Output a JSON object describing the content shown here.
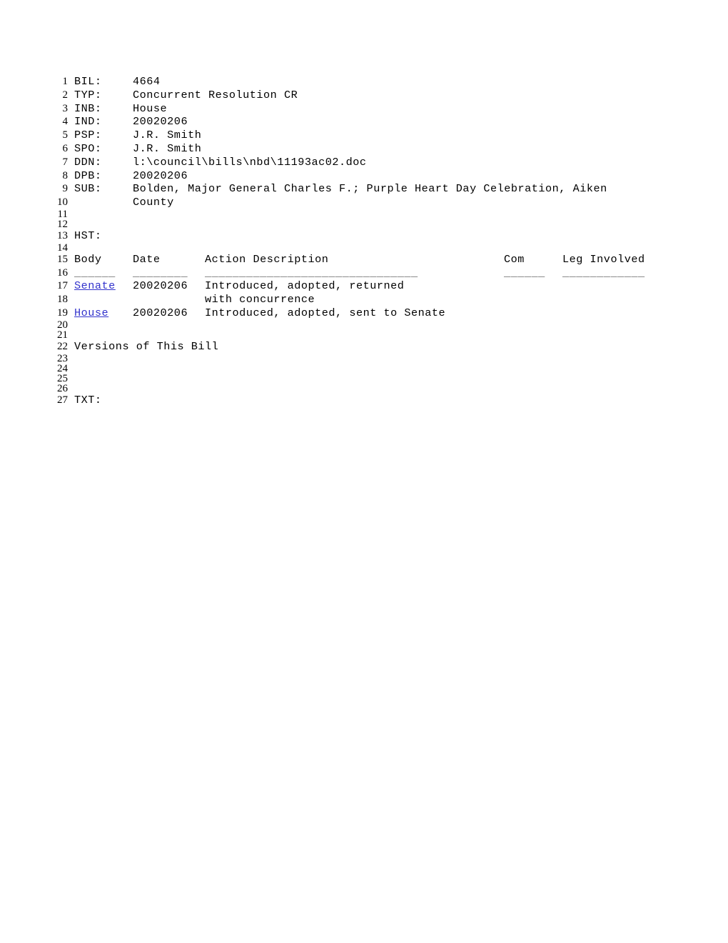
{
  "document": {
    "type": "legislative-bill-record",
    "line_count": 27
  },
  "fields": {
    "bil_label": "BIL:",
    "bil_value": "4664",
    "typ_label": "TYP:",
    "typ_value": "Concurrent Resolution CR",
    "inb_label": "INB:",
    "inb_value": "House",
    "ind_label": "IND:",
    "ind_value": "20020206",
    "psp_label": "PSP:",
    "psp_value": "J.R. Smith",
    "spo_label": "SPO:",
    "spo_value": "J.R. Smith",
    "ddn_label": "DDN:",
    "ddn_value": "l:\\council\\bills\\nbd\\11193ac02.doc",
    "dpb_label": "DPB:",
    "dpb_value": "20020206",
    "sub_label": "SUB:",
    "sub_value_line1": "Bolden, Major General Charles F.; Purple Heart Day Celebration, Aiken",
    "sub_value_line2": "County",
    "hst_label": "HST:",
    "txt_label": "TXT:"
  },
  "history": {
    "headers": {
      "body": "Body",
      "date": "Date",
      "action": "Action Description",
      "com": "Com",
      "leg": "Leg Involved"
    },
    "separators": {
      "body": "______",
      "date": "________",
      "action": "_______________________________",
      "com": "______",
      "leg": "____________"
    },
    "rows": [
      {
        "body": "Senate",
        "body_is_link": true,
        "date": "20020206",
        "action": "Introduced, adopted, returned",
        "action_cont": "with concurrence",
        "com": "",
        "leg": ""
      },
      {
        "body": "House",
        "body_is_link": true,
        "date": "20020206",
        "action": "Introduced, adopted, sent to Senate",
        "action_cont": "",
        "com": "",
        "leg": ""
      }
    ]
  },
  "sections": {
    "versions_heading": "Versions of This Bill"
  },
  "line_numbers": [
    "1",
    "2",
    "3",
    "4",
    "5",
    "6",
    "7",
    "8",
    "9",
    "10",
    "11",
    "12",
    "13",
    "14",
    "15",
    "16",
    "17",
    "18",
    "19",
    "20",
    "21",
    "22",
    "23",
    "24",
    "25",
    "26",
    "27"
  ],
  "colors": {
    "link": "#3333cc",
    "text": "#000000",
    "rule": "#555555",
    "page_background": "#ffffff"
  }
}
